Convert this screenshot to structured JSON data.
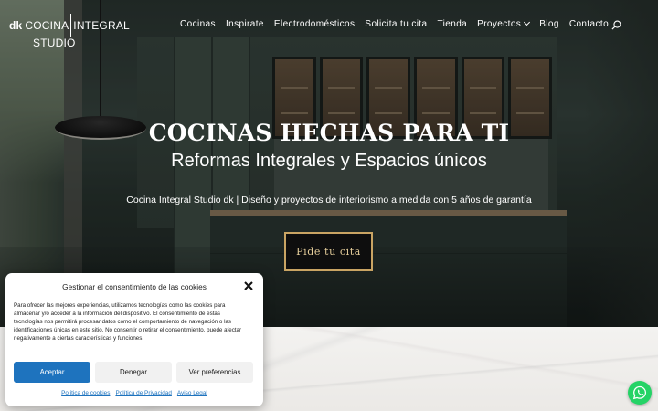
{
  "brand": {
    "logo_dk": "dk",
    "logo_part1": "COCINA",
    "logo_part2": "INTEGRAL",
    "logo_line2": "STUDIO"
  },
  "nav": {
    "items": [
      "Cocinas",
      "Inspirate",
      "Electrodomésticos",
      "Solicita tu cita",
      "Tienda",
      "Proyectos",
      "Blog",
      "Contacto"
    ],
    "dropdown_item": "Proyectos",
    "search_icon": "search-icon"
  },
  "hero": {
    "title": "COCINAS HECHAS PARA TI",
    "subtitle": "Reformas Integrales y Espacios únicos",
    "description": "Cocina Integral Studio dk | Diseño y proyectos de interiorismo a medida con 5 años de garantía",
    "cta_label": "Pide tu cita"
  },
  "cookie": {
    "title": "Gestionar el consentimiento de las cookies",
    "body": "Para ofrecer las mejores experiencias, utilizamos tecnologías como las cookies para almacenar y/o acceder a la información del dispositivo. El consentimiento de estas tecnologías nos permitirá procesar datos como el comportamiento de navegación o las identificaciones únicas en este sitio. No consentir o retirar el consentimiento, puede afectar negativamente a ciertas características y funciones.",
    "accept_label": "Aceptar",
    "deny_label": "Denegar",
    "prefs_label": "Ver preferencias",
    "links": [
      "Política de cookies",
      "Política de Privacidad",
      "Aviso Legal"
    ]
  },
  "colors": {
    "accent_blue": "#1e73be",
    "cta_border": "#c9a463",
    "whatsapp": "#25d366"
  }
}
